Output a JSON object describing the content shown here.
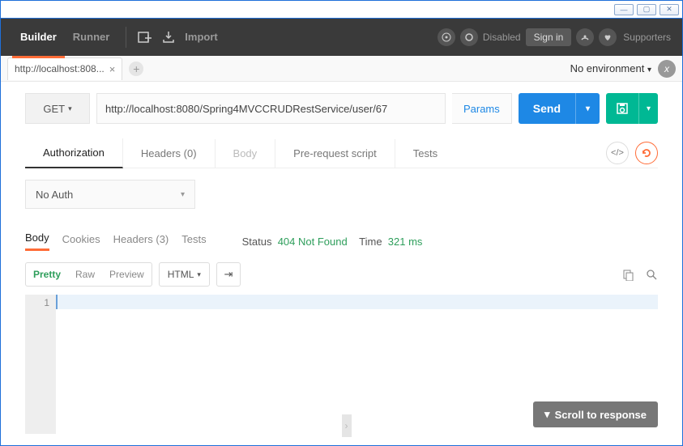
{
  "topbar": {
    "builder": "Builder",
    "runner": "Runner",
    "import": "Import",
    "disabled": "Disabled",
    "signin": "Sign in",
    "supporters": "Supporters"
  },
  "tabs": {
    "title": "http://localhost:808...",
    "env": "No environment"
  },
  "request": {
    "method": "GET",
    "url": "http://localhost:8080/Spring4MVCCRUDRestService/user/67",
    "params": "Params",
    "send": "Send"
  },
  "reqtabs": {
    "auth": "Authorization",
    "headers": "Headers (0)",
    "body": "Body",
    "prereq": "Pre-request script",
    "tests": "Tests"
  },
  "auth": {
    "type": "No Auth"
  },
  "resptabs": {
    "body": "Body",
    "cookies": "Cookies",
    "headers": "Headers (3)",
    "tests": "Tests"
  },
  "status": {
    "label": "Status",
    "value": "404 Not Found",
    "timelabel": "Time",
    "timevalue": "321 ms"
  },
  "view": {
    "pretty": "Pretty",
    "raw": "Raw",
    "preview": "Preview",
    "format": "HTML"
  },
  "editor": {
    "line1": "1"
  },
  "scroll": "Scroll to response"
}
